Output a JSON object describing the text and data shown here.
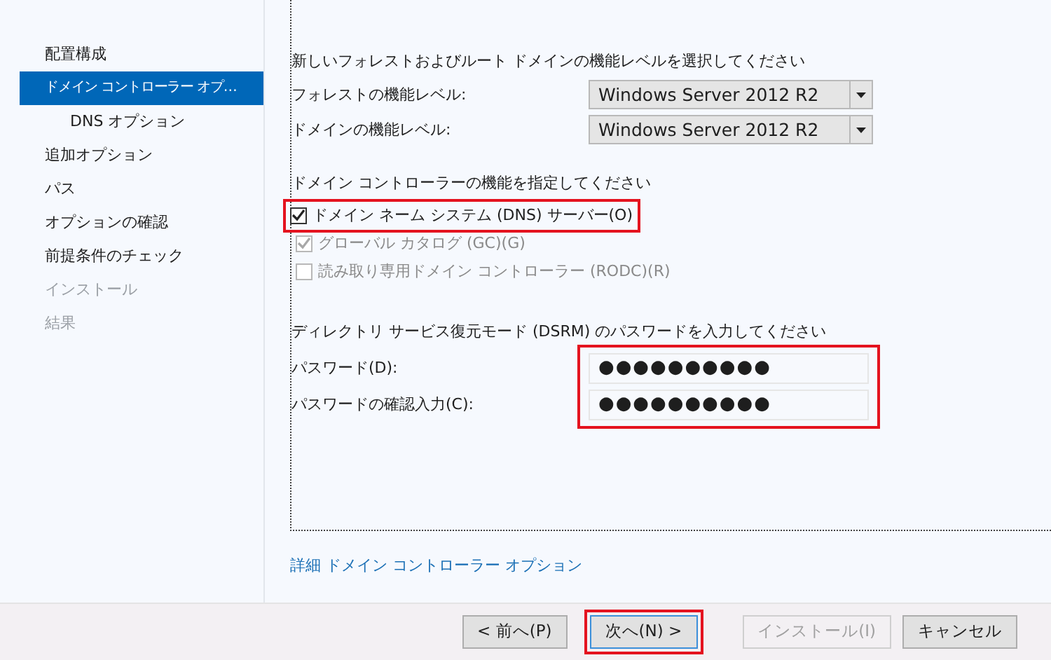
{
  "sidebar": {
    "items": [
      {
        "label": "配置構成",
        "selected": false,
        "disabled": false
      },
      {
        "label": "ドメイン コントローラー オプ…",
        "selected": true,
        "disabled": false,
        "children": [
          {
            "label": "DNS オプション",
            "selected": false,
            "disabled": false
          }
        ]
      },
      {
        "label": "追加オプション",
        "selected": false,
        "disabled": false
      },
      {
        "label": "パス",
        "selected": false,
        "disabled": false
      },
      {
        "label": "オプションの確認",
        "selected": false,
        "disabled": false
      },
      {
        "label": "前提条件のチェック",
        "selected": false,
        "disabled": false
      },
      {
        "label": "インストール",
        "selected": false,
        "disabled": true
      },
      {
        "label": "結果",
        "selected": false,
        "disabled": true
      }
    ]
  },
  "functional_levels": {
    "heading": "新しいフォレストおよびルート ドメインの機能レベルを選択してください",
    "fields": [
      {
        "label": "フォレストの機能レベル:",
        "value": "Windows Server 2012 R2"
      },
      {
        "label": "ドメインの機能レベル:",
        "value": "Windows Server 2012 R2"
      }
    ]
  },
  "capabilities": {
    "heading": "ドメイン コントローラーの機能を指定してください",
    "options": [
      {
        "label": "ドメイン ネーム システム (DNS) サーバー(O)",
        "checked": true,
        "disabled": false,
        "highlighted": true
      },
      {
        "label": "グローバル カタログ (GC)(G)",
        "checked": true,
        "disabled": true,
        "highlighted": false
      },
      {
        "label": "読み取り専用ドメイン コントローラー (RODC)(R)",
        "checked": false,
        "disabled": true,
        "highlighted": false
      }
    ]
  },
  "dsrm": {
    "heading": "ディレクトリ サービス復元モード (DSRM) のパスワードを入力してください",
    "highlighted": true,
    "fields": [
      {
        "label": "パスワード(D):",
        "value": "●●●●●●●●●●"
      },
      {
        "label": "パスワードの確認入力(C):",
        "value": "●●●●●●●●●●"
      }
    ]
  },
  "link": "詳細 ドメイン コントローラー オプション",
  "buttons": [
    {
      "label": "< 前へ(P)",
      "disabled": false,
      "highlighted": false
    },
    {
      "label": "次へ(N) >",
      "disabled": false,
      "highlighted": true
    },
    {
      "label": "インストール(I)",
      "disabled": true,
      "highlighted": false
    },
    {
      "label": "キャンセル",
      "disabled": false,
      "highlighted": false
    }
  ]
}
